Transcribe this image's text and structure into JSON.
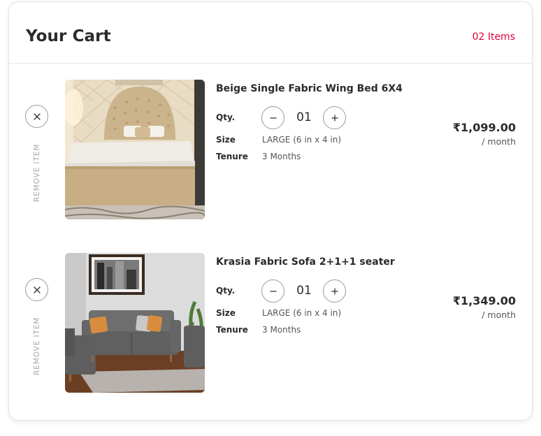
{
  "header": {
    "title": "Your Cart",
    "item_count": "02 Items"
  },
  "colors": {
    "accent": "#e4003b",
    "text": "#2b2b2b",
    "muted": "#a8a8a8"
  },
  "labels": {
    "qty": "Qty.",
    "size": "Size",
    "tenure": "Tenure",
    "remove": "REMOVE ITEM",
    "per_month": "/ month"
  },
  "items": [
    {
      "name": "Beige Single Fabric Wing Bed 6X4",
      "qty": "01",
      "size": "LARGE (6 in x 4 in)",
      "tenure": "3 Months",
      "price": "₹1,099.00",
      "image_icon": "bed-image"
    },
    {
      "name": "Krasia Fabric Sofa 2+1+1 seater",
      "qty": "01",
      "size": "LARGE (6 in x 4 in)",
      "tenure": "3 Months",
      "price": "₹1,349.00",
      "image_icon": "sofa-image"
    }
  ]
}
